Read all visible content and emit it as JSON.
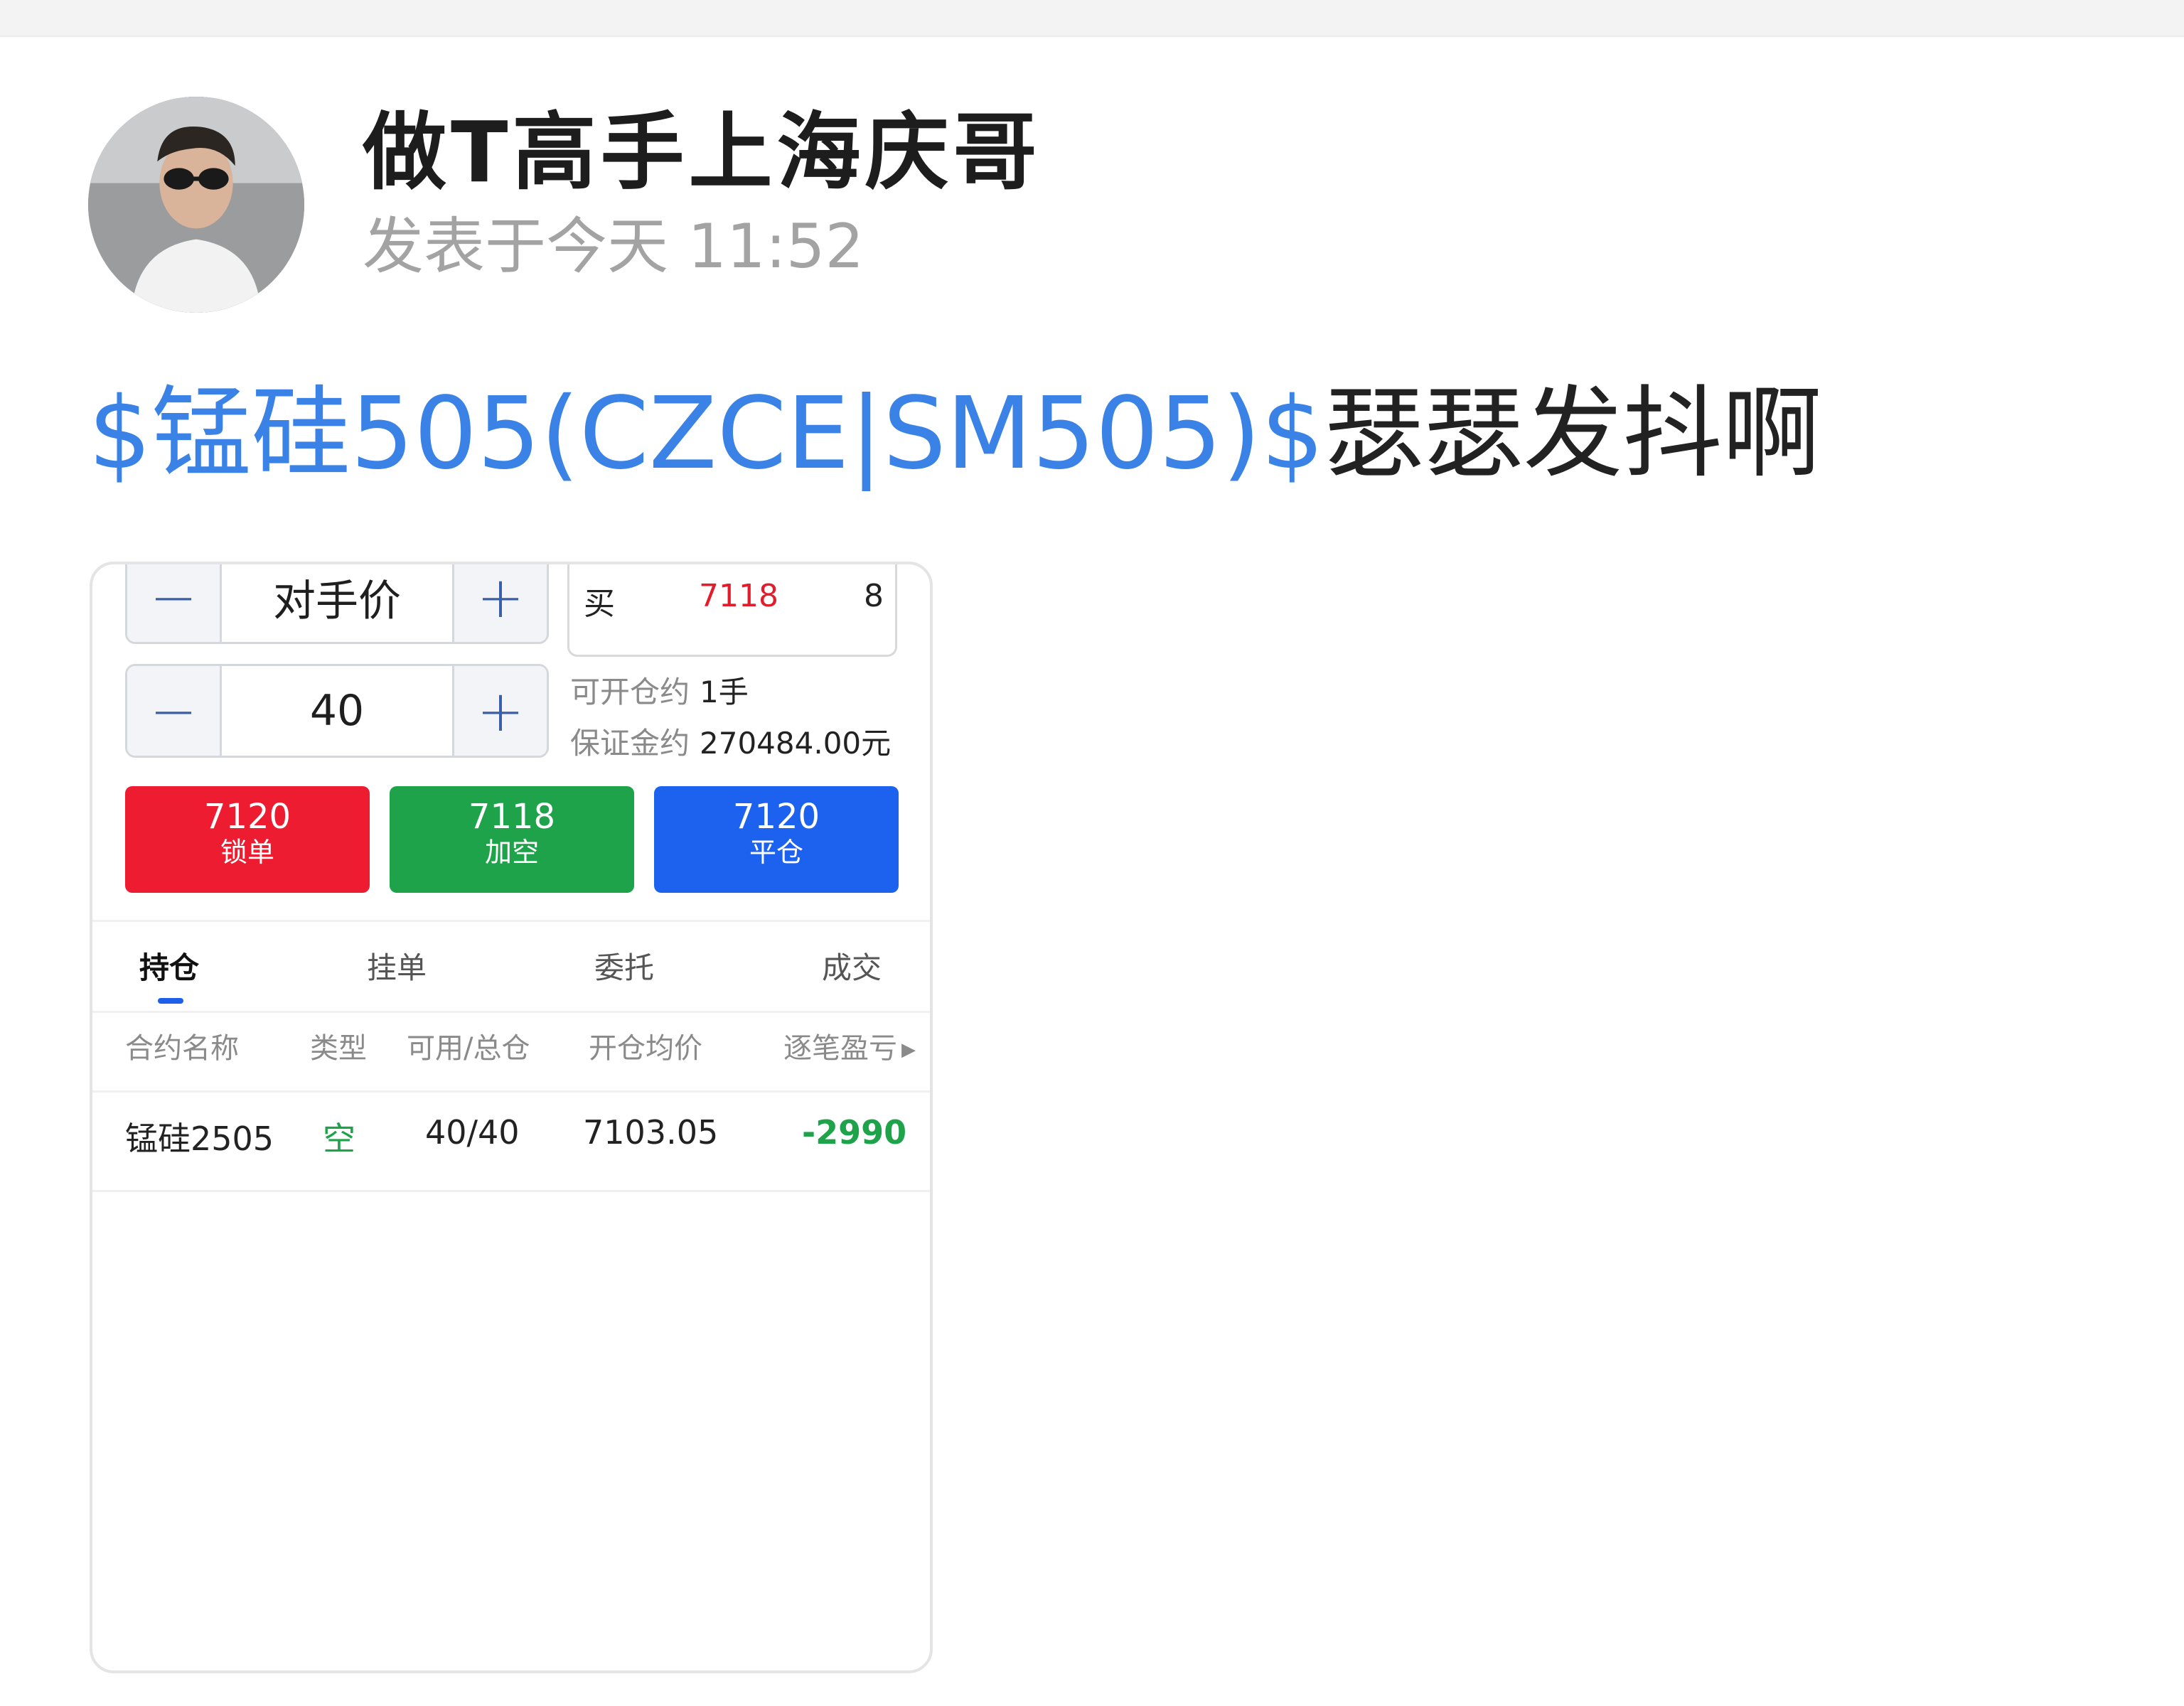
{
  "author": {
    "name": "做T高手上海庆哥",
    "post_time": "发表于今天 11:52"
  },
  "post": {
    "stock_link": "$锰硅505(CZCE|SM505)$",
    "body": "瑟瑟发抖啊"
  },
  "trade_panel": {
    "price_type": {
      "minus": "−",
      "value": "对手价",
      "plus": "+"
    },
    "quantity": {
      "minus": "−",
      "value": "40",
      "plus": "+"
    },
    "quote": {
      "side": "买",
      "price": "7118",
      "volume": "8"
    },
    "openable": {
      "label": "可开仓约",
      "value": "1手"
    },
    "margin": {
      "label": "保证金约",
      "value": "270484.00元"
    },
    "buttons": [
      {
        "price": "7120",
        "label": "锁单",
        "color": "#ee1c31"
      },
      {
        "price": "7118",
        "label": "加空",
        "color": "#1ea24a"
      },
      {
        "price": "7120",
        "label": "平仓",
        "color": "#1d62ee"
      }
    ],
    "tabs": [
      "持仓",
      "挂单",
      "委托",
      "成交"
    ],
    "active_tab": "持仓",
    "columns": [
      "合约名称",
      "类型",
      "可用/总仓",
      "开仓均价",
      "逐笔盈亏"
    ],
    "positions": [
      {
        "contract": "锰硅2505",
        "type": "空",
        "avail_total": "40/40",
        "avg_price": "7103.05",
        "pnl": "-2990"
      }
    ]
  },
  "colors": {
    "link_blue": "#3b82e6",
    "up_red": "#e11d2b",
    "down_green": "#1ea24a"
  }
}
